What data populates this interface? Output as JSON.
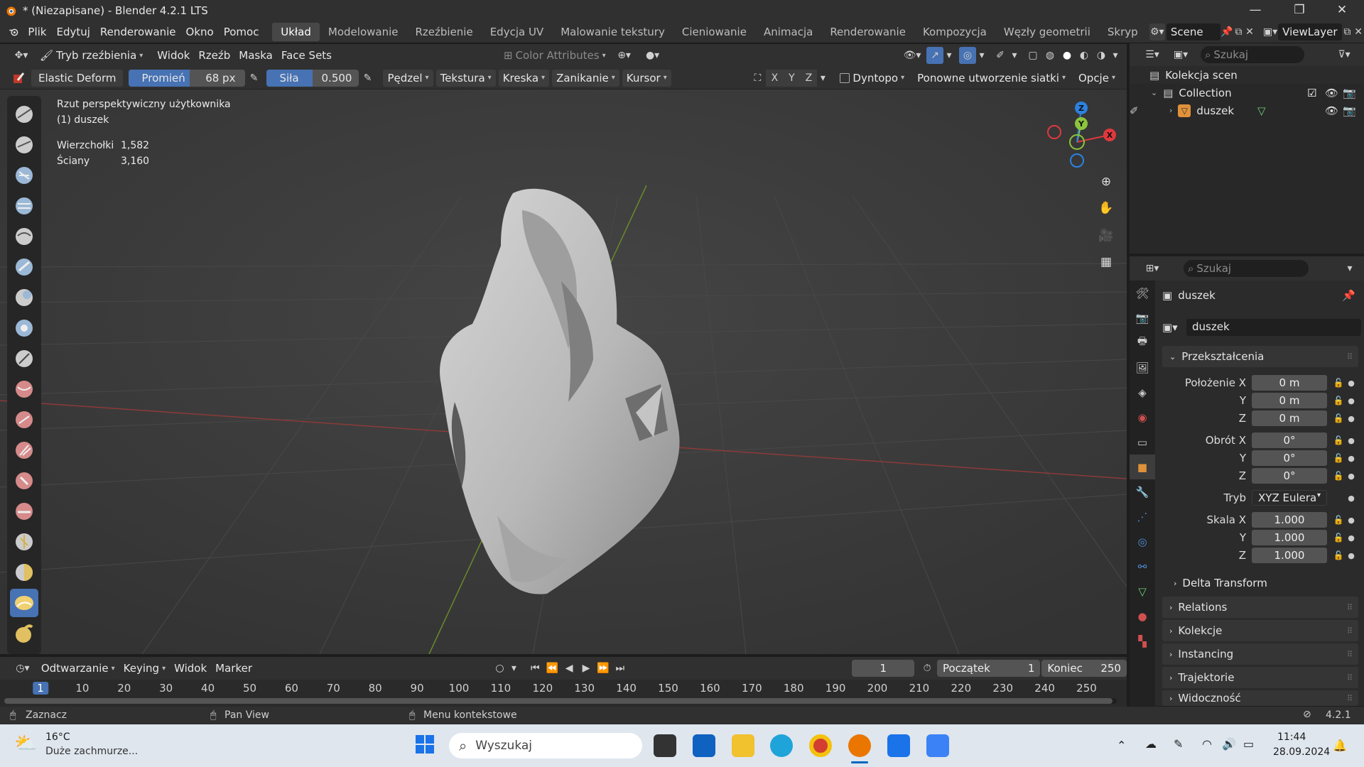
{
  "window": {
    "title": "* (Niezapisane) - Blender 4.2.1 LTS",
    "minimize": "—",
    "maximize": "❐",
    "close": "✕"
  },
  "menu": {
    "items": [
      "Plik",
      "Edytuj",
      "Renderowanie",
      "Okno",
      "Pomoc"
    ]
  },
  "workspaces": [
    "Układ",
    "Modelowanie",
    "Rzeźbienie",
    "Edycja UV",
    "Malowanie tekstury",
    "Cieniowanie",
    "Animacja",
    "Renderowanie",
    "Kompozycja",
    "Węzły geometrii",
    "Skryp"
  ],
  "scene": {
    "label": "Scene",
    "view_layer": "ViewLayer"
  },
  "viewport_header": {
    "mode": "Tryb rzeźbienia",
    "menus": [
      "Widok",
      "Rzeźb",
      "Maska",
      "Face Sets"
    ],
    "color_attributes": "Color Attributes"
  },
  "tool_settings": {
    "brush": "Elastic Deform",
    "radius_label": "Promień",
    "radius_value": "68 px",
    "strength_label": "Siła",
    "strength_value": "0.500",
    "strength_fraction": 0.5,
    "menus": [
      "Pędzel",
      "Tekstura",
      "Kreska",
      "Zanikanie",
      "Kursor"
    ],
    "axes": [
      "X",
      "Y",
      "Z"
    ],
    "dyntopo": "Dyntopo",
    "remesh": "Ponowne utworzenie siatki",
    "options": "Opcje"
  },
  "viewport_info": {
    "view_name": "Rzut perspektywiczny użytkownika",
    "object": "(1) duszek",
    "vertices_label": "Wierzchołki",
    "vertices_value": "1,582",
    "faces_label": "Ściany",
    "faces_value": "3,160"
  },
  "gizmo": {
    "x": "X",
    "y": "Y",
    "z": "Z"
  },
  "outliner": {
    "search_placeholder": "Szukaj",
    "scene_collection": "Kolekcja scen",
    "collection": "Collection",
    "object": "duszek"
  },
  "properties": {
    "search_placeholder": "Szukaj",
    "object_name": "duszek",
    "datablock_name": "duszek",
    "transform_header": "Przekształcenia",
    "location_label": "Położenie X",
    "location": [
      "0 m",
      "0 m",
      "0 m"
    ],
    "rotation_label": "Obrót X",
    "rotation": [
      "0°",
      "0°",
      "0°"
    ],
    "mode_label": "Tryb",
    "mode_value": "XYZ Eulera",
    "scale_label": "Skala X",
    "scale": [
      "1.000",
      "1.000",
      "1.000"
    ],
    "y_label": "Y",
    "z_label": "Z",
    "delta": "Delta Transform",
    "panels": [
      "Relations",
      "Kolekcje",
      "Instancing",
      "Trajektorie",
      "Widoczność"
    ]
  },
  "timeline": {
    "menus": [
      "Odtwarzanie",
      "Keying",
      "Widok",
      "Marker"
    ],
    "current_frame": "1",
    "start_label": "Początek",
    "start_value": "1",
    "end_label": "Koniec",
    "end_value": "250",
    "ruler": [
      "1",
      "10",
      "20",
      "30",
      "40",
      "50",
      "60",
      "70",
      "80",
      "90",
      "100",
      "110",
      "120",
      "130",
      "140",
      "150",
      "160",
      "170",
      "180",
      "190",
      "200",
      "210",
      "220",
      "230",
      "240",
      "250"
    ]
  },
  "status": {
    "select": "Zaznacz",
    "pan": "Pan View",
    "context": "Menu kontekstowe",
    "version": "4.2.1"
  },
  "taskbar": {
    "temp": "16°C",
    "weather": "Duże zachmurze...",
    "search_placeholder": "Wyszukaj",
    "time": "11:44",
    "date": "28.09.2024"
  },
  "colors": {
    "accent": "#4772b3",
    "x_axis": "#e0383d",
    "y_axis": "#8cc43c",
    "z_axis": "#2c82e0",
    "header": "#303030"
  }
}
